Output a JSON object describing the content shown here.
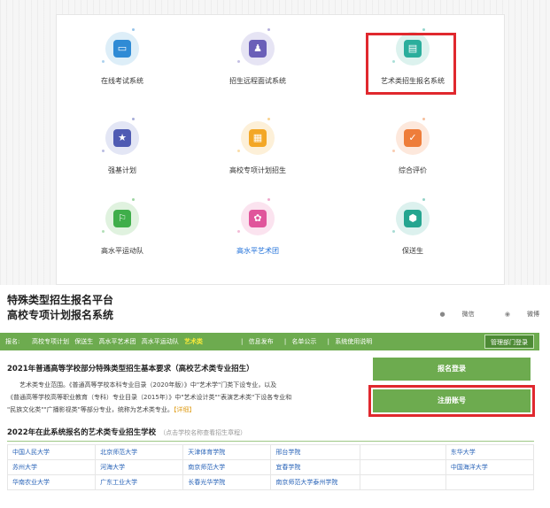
{
  "systems": [
    {
      "label": "在线考试系统",
      "icon": "monitor-icon",
      "bg": "#ddeef8",
      "fg": "#2f8bd5"
    },
    {
      "label": "招生远程面试系统",
      "icon": "interview-icon",
      "bg": "#e6e4f4",
      "fg": "#6a5fb8"
    },
    {
      "label": "艺术类招生报名系统",
      "icon": "document-icon",
      "bg": "#dcf2ee",
      "fg": "#2aae9c"
    },
    {
      "label": "强基计划",
      "icon": "shield-star-icon",
      "bg": "#e3e6f5",
      "fg": "#4f5bb3"
    },
    {
      "label": "高校专项计划招生",
      "icon": "apps-grid-icon",
      "bg": "#fdf0d8",
      "fg": "#f3a726"
    },
    {
      "label": "综合评价",
      "icon": "clipboard-check-icon",
      "bg": "#fde8dc",
      "fg": "#ee7d3a"
    },
    {
      "label": "高水平运动队",
      "icon": "runner-icon",
      "bg": "#e0f2df",
      "fg": "#3fae4a"
    },
    {
      "label": "高水平艺术团",
      "icon": "dancers-icon",
      "bg": "#fbe3ef",
      "fg": "#e0559b"
    },
    {
      "label": "保送生",
      "icon": "badge-icon",
      "bg": "#dcf1ee",
      "fg": "#25a590"
    }
  ],
  "platform": {
    "title_line1": "特殊类型招生报名平台",
    "title_line2": "高校专项计划报名系统"
  },
  "share": {
    "weixin": "微信",
    "weibo": "微博"
  },
  "nav": {
    "prefix": "报名:",
    "items": [
      "高校专项计划",
      "保送生",
      "高水平艺术团",
      "高水平运动队"
    ],
    "active": "艺术类",
    "links": [
      "信息发布",
      "名单公示",
      "系统使用说明"
    ],
    "admin": "管理部门登录"
  },
  "requirements": {
    "title": "2021年普通高等学校部分特殊类型招生基本要求（高校艺术类专业招生）",
    "line1": "艺术类专业范围。《普通高等学校本科专业目录（2020年版）》中\"艺术学\"门类下设专业，以及",
    "line2": "《普通高等学校高等职业教育（专科）专业目录（2015年）》中\"艺术设计类\"\"表演艺术类\"下设各专业和",
    "line3": "\"民族文化类\"\"广播影视类\"等部分专业，统称为艺术类专业。",
    "detail": "【详细】"
  },
  "buttons": {
    "login": "报名登录",
    "register": "注册账号"
  },
  "schools": {
    "title": "2022年在此系统报名的艺术类专业招生学校",
    "hint": "（点击学校名称查看招生章程）",
    "rows": [
      [
        "中国人民大学",
        "北京师范大学",
        "天津体育学院",
        "邢台学院",
        "",
        "东华大学"
      ],
      [
        "苏州大学",
        "河海大学",
        "南京师范大学",
        "宜春学院",
        "",
        "中国海洋大学"
      ],
      [
        "华南农业大学",
        "广东工业大学",
        "长春光华学院",
        "南京师范大学泰州学院",
        "",
        ""
      ]
    ]
  }
}
